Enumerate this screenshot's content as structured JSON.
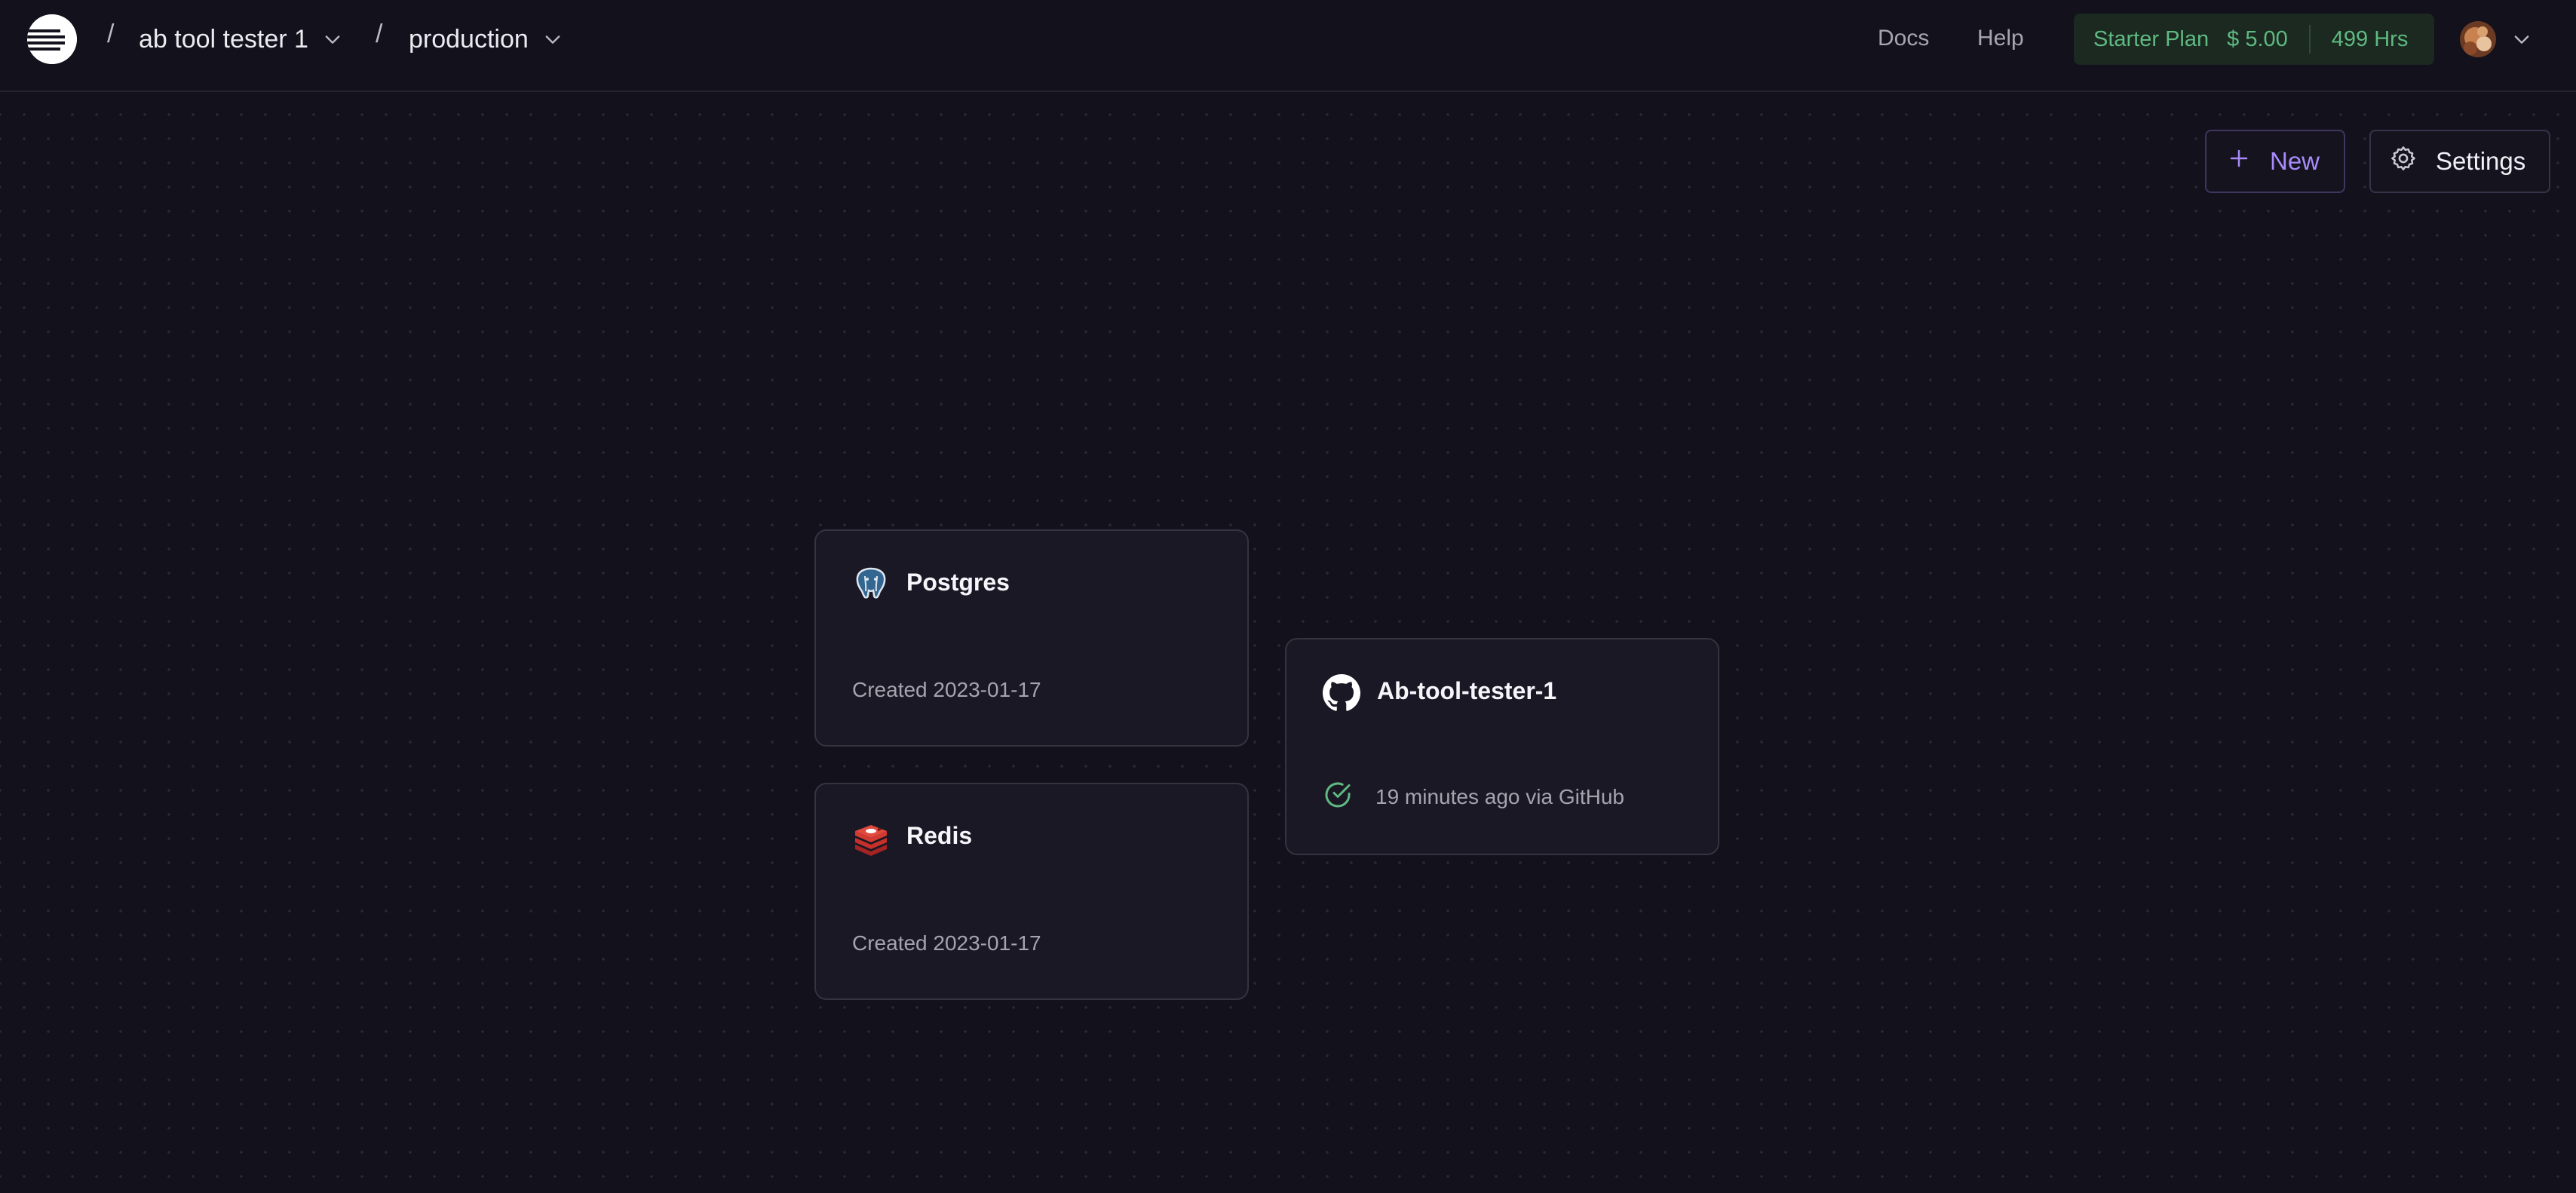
{
  "header": {
    "logo_icon": "railway-logo-icon",
    "separator": "/",
    "project_name": "ab tool tester 1",
    "environment": "production",
    "docs_label": "Docs",
    "help_label": "Help",
    "plan": {
      "name": "Starter Plan",
      "price": "$ 5.00",
      "hours": "499 Hrs",
      "color": "#5fb981"
    }
  },
  "toolbar": {
    "new_label": "New",
    "settings_label": "Settings",
    "accent_color": "#a78bfa"
  },
  "services": [
    {
      "name": "Postgres",
      "icon": "postgres-icon",
      "meta": "Created 2023-01-17"
    },
    {
      "name": "Redis",
      "icon": "redis-icon",
      "meta": "Created 2023-01-17"
    },
    {
      "name": "Ab-tool-tester-1",
      "icon": "github-icon",
      "status_icon": "check-circle-icon",
      "meta": "19 minutes ago via GitHub",
      "status_color": "#5fb981"
    }
  ]
}
